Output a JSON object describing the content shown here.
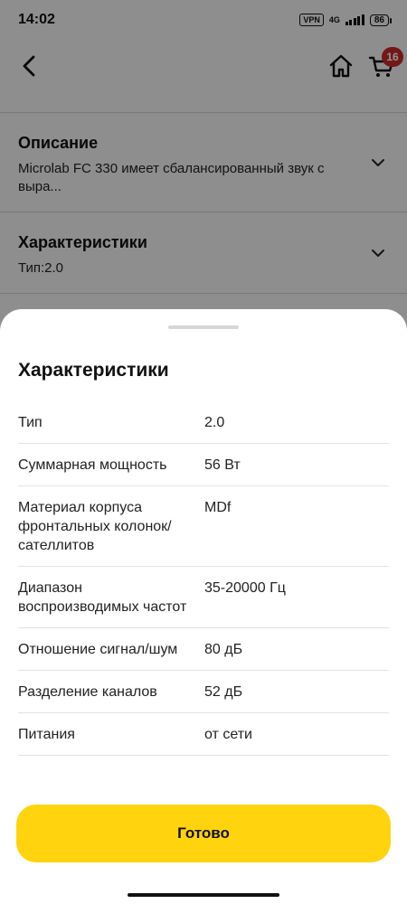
{
  "status_bar": {
    "time": "14:02",
    "vpn": "VPN",
    "network": "4G",
    "battery": "86"
  },
  "app_bar": {
    "cart_count": "16"
  },
  "background": {
    "description": {
      "title": "Описание",
      "text": "Microlab FC 330 имеет сбалансированный звук с выра..."
    },
    "specs": {
      "title": "Характеристики",
      "text": "Тип:2.0"
    }
  },
  "sheet": {
    "title": "Характеристики",
    "rows": [
      {
        "name": "Тип",
        "value": "2.0"
      },
      {
        "name": "Суммарная мощность",
        "value": "56 Вт"
      },
      {
        "name": "Материал корпуса фронтальных колонок/сателлитов",
        "value": "MDf"
      },
      {
        "name": "Диапазон воспроизводимых частот",
        "value": "35-20000 Гц"
      },
      {
        "name": "Отношение сигнал/шум",
        "value": "80 дБ"
      },
      {
        "name": "Разделение каналов",
        "value": "52 дБ"
      },
      {
        "name": "Питания",
        "value": "от сети"
      }
    ],
    "done_label": "Готово"
  },
  "colors": {
    "accent": "#ffd30d",
    "badge": "#c62828"
  }
}
